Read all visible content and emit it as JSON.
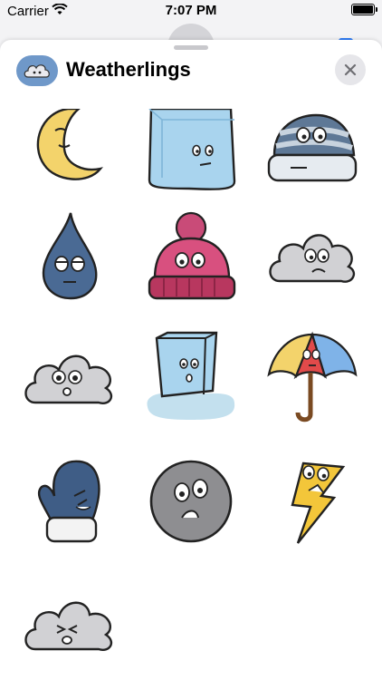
{
  "status_bar": {
    "carrier": "Carrier",
    "time": "7:07 PM"
  },
  "header": {
    "title": "Weatherlings"
  },
  "colors": {
    "accent": "#6f98c9",
    "close_bg": "#e6e6ea"
  },
  "stickers": [
    {
      "name": "moon",
      "icon": "moon-sticker-icon"
    },
    {
      "name": "ice-cube",
      "icon": "ice-cube-sticker-icon"
    },
    {
      "name": "striped-beanie",
      "icon": "striped-beanie-sticker-icon"
    },
    {
      "name": "raindrop",
      "icon": "raindrop-sticker-icon"
    },
    {
      "name": "pink-beanie",
      "icon": "pink-beanie-sticker-icon"
    },
    {
      "name": "worried-cloud",
      "icon": "worried-cloud-sticker-icon"
    },
    {
      "name": "happy-cloud",
      "icon": "happy-cloud-sticker-icon"
    },
    {
      "name": "melting-ice-cube",
      "icon": "melting-ice-cube-sticker-icon"
    },
    {
      "name": "umbrella",
      "icon": "umbrella-sticker-icon"
    },
    {
      "name": "mitten",
      "icon": "mitten-sticker-icon"
    },
    {
      "name": "hailstone",
      "icon": "hailstone-sticker-icon"
    },
    {
      "name": "lightning-bolt",
      "icon": "lightning-bolt-sticker-icon"
    },
    {
      "name": "grumpy-cloud",
      "icon": "grumpy-cloud-sticker-icon"
    }
  ]
}
